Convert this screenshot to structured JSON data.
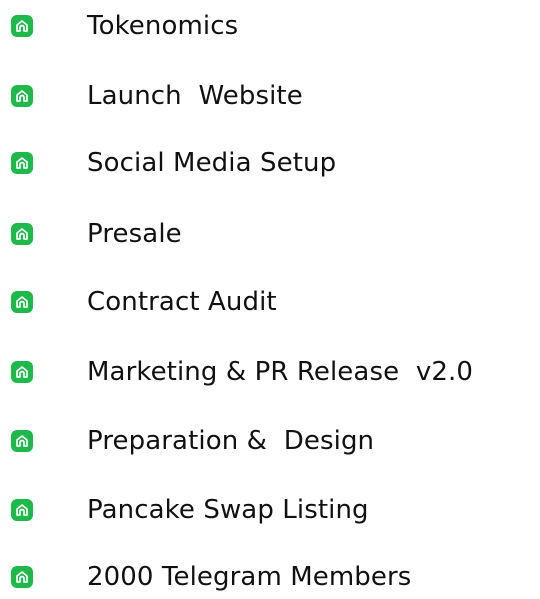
{
  "roadmap": {
    "accent_color": "#1fb84a",
    "icon_name": "house-check-icon",
    "items": [
      {
        "label": "Tokenomics"
      },
      {
        "label": "Launch  Website"
      },
      {
        "label": "Social Media Setup"
      },
      {
        "label": "Presale"
      },
      {
        "label": "Contract Audit"
      },
      {
        "label": "Marketing & PR Release  v2.0"
      },
      {
        "label": "Preparation &  Design"
      },
      {
        "label": "Pancake Swap Listing"
      },
      {
        "label": "2000 Telegram Members"
      }
    ]
  }
}
